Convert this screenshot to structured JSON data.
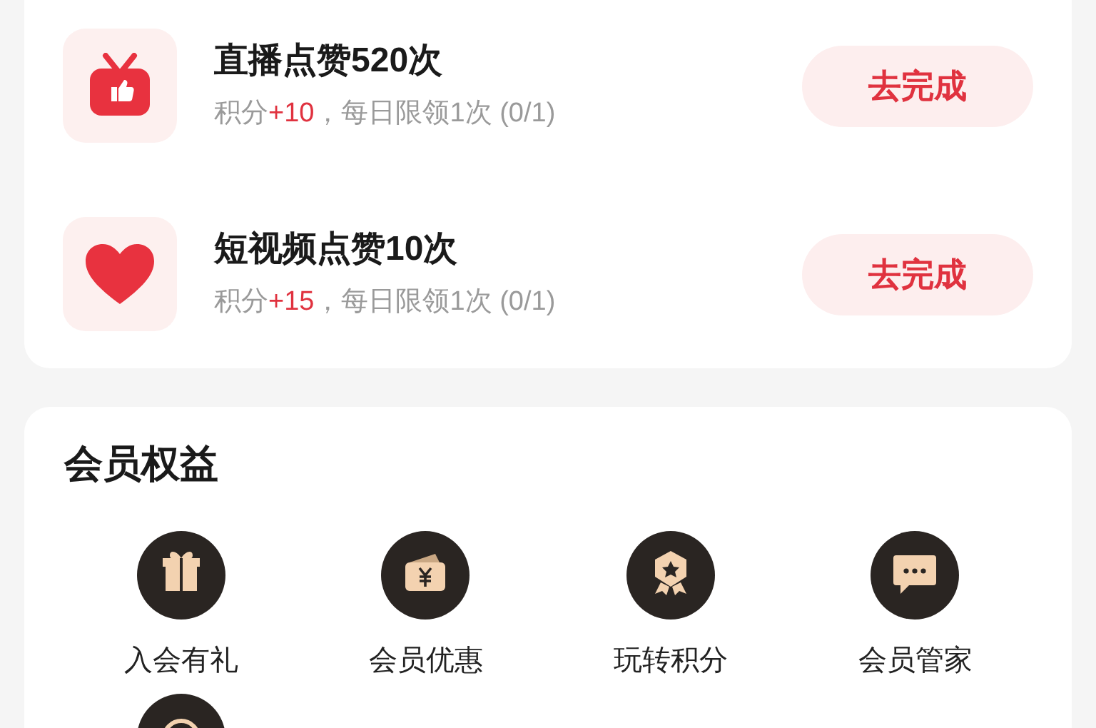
{
  "tasks": [
    {
      "kind": "live-like",
      "title": "直播点赞520次",
      "points_label": "积分",
      "points": "+10",
      "limit": "，每日限领1次 (0/1)",
      "button": "去完成"
    },
    {
      "kind": "video-like",
      "title": "短视频点赞10次",
      "points_label": "积分",
      "points": "+15",
      "limit": "，每日限领1次 (0/1)",
      "button": "去完成"
    }
  ],
  "benefits": {
    "title": "会员权益",
    "items": [
      {
        "kind": "gift",
        "label": "入会有礼"
      },
      {
        "kind": "coupon",
        "label": "会员优惠"
      },
      {
        "kind": "badge",
        "label": "玩转积分"
      },
      {
        "kind": "chat",
        "label": "会员管家"
      },
      {
        "kind": "more"
      }
    ]
  }
}
